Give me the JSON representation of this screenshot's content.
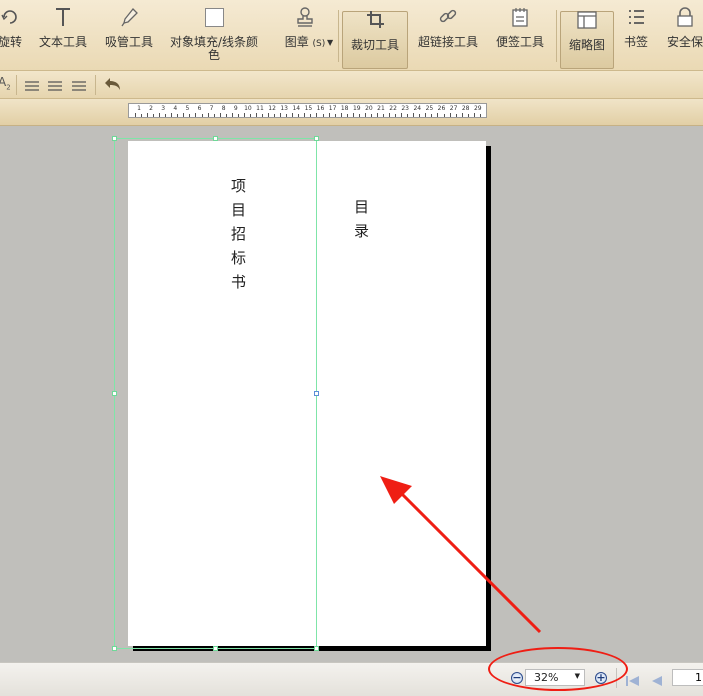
{
  "toolbar": {
    "tools": [
      {
        "id": "rotate",
        "label": "旋转"
      },
      {
        "id": "text",
        "label": "文本工具"
      },
      {
        "id": "eyedropper",
        "label": "吸管工具"
      },
      {
        "id": "fill",
        "label": "对象填充/线条颜色"
      },
      {
        "id": "stamp",
        "label": "图章",
        "suffix": "(S)"
      },
      {
        "id": "crop",
        "label": "裁切工具",
        "active": true
      },
      {
        "id": "hyperlink",
        "label": "超链接工具"
      },
      {
        "id": "note",
        "label": "便签工具"
      },
      {
        "id": "thumbnail",
        "label": "缩略图",
        "active": true
      },
      {
        "id": "bookmark",
        "label": "书签"
      },
      {
        "id": "security",
        "label": "安全保"
      }
    ]
  },
  "ruler": {
    "ticks": [
      "1",
      "2",
      "3",
      "4",
      "5",
      "6",
      "7",
      "8",
      "9",
      "10",
      "11",
      "12",
      "13",
      "14",
      "15",
      "16",
      "17",
      "18",
      "19",
      "20",
      "21",
      "22",
      "23",
      "24",
      "25",
      "26",
      "27",
      "28",
      "29"
    ]
  },
  "document": {
    "left_title": "项目招标书",
    "right_title": "目录"
  },
  "status": {
    "zoom": "32%",
    "page_number": "1"
  },
  "colors": {
    "annotation": "#ef1e14",
    "toolbar": "#ead9b4",
    "divider": "#a33a30"
  }
}
